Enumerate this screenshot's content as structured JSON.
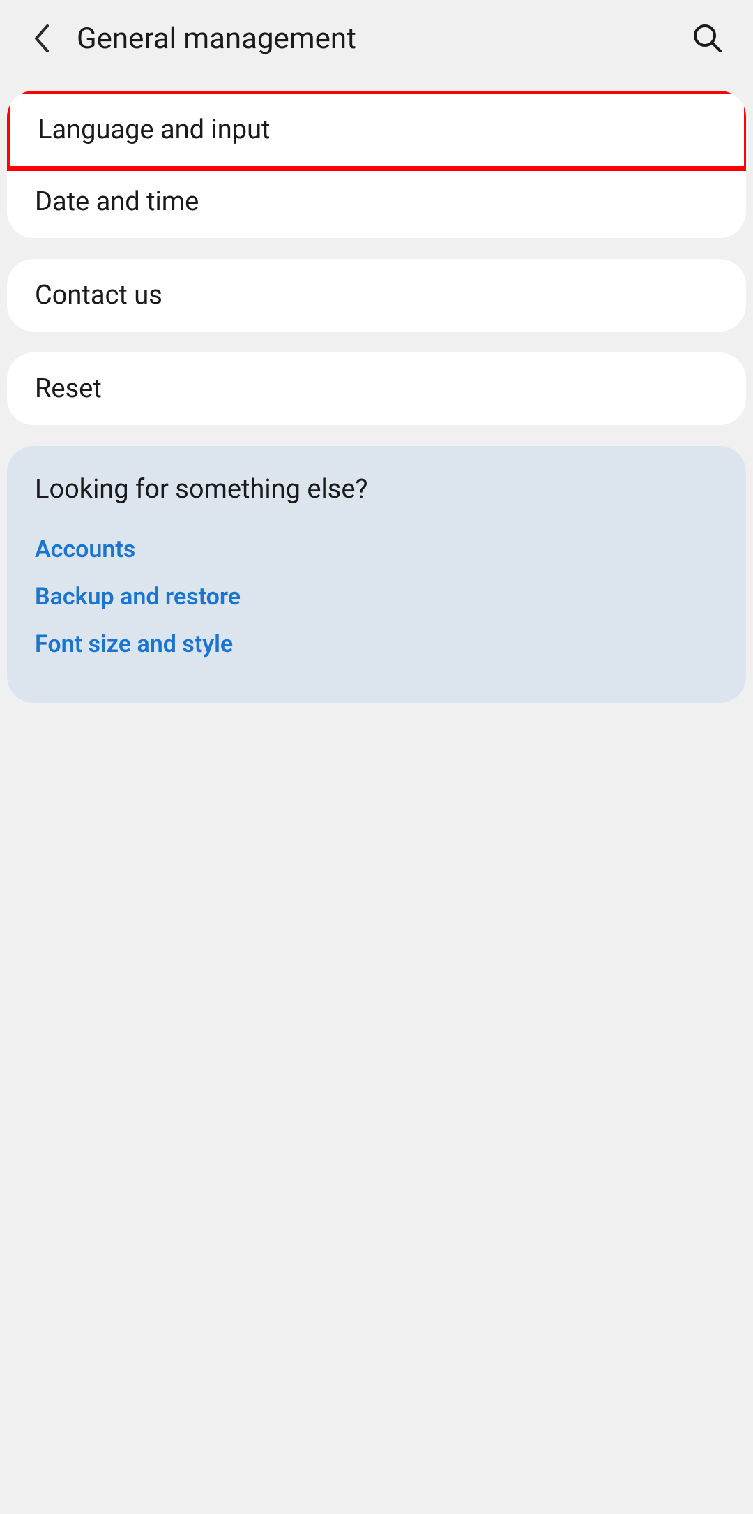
{
  "header": {
    "title": "General management"
  },
  "sections": {
    "group1": {
      "item1": "Language and input",
      "item2": "Date and time"
    },
    "group2": {
      "item1": "Contact us"
    },
    "group3": {
      "item1": "Reset"
    }
  },
  "suggestions": {
    "title": "Looking for something else?",
    "links": {
      "link1": "Accounts",
      "link2": "Backup and restore",
      "link3": "Font size and style"
    }
  }
}
